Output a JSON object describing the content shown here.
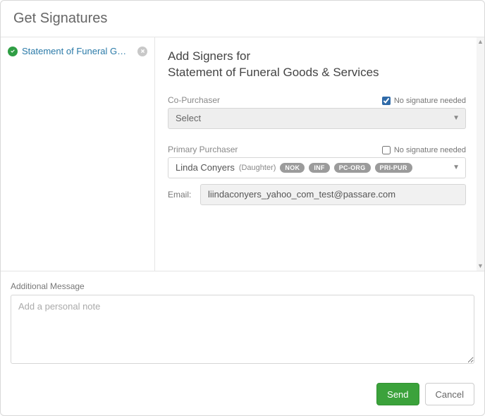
{
  "header": {
    "title": "Get Signatures"
  },
  "sidebar": {
    "documents": [
      {
        "name": "Statement of Funeral G…"
      }
    ]
  },
  "main": {
    "heading_line1": "Add Signers for",
    "heading_line2": "Statement of Funeral Goods & Services",
    "co_purchaser": {
      "label": "Co-Purchaser",
      "no_sig_label": "No signature needed",
      "no_sig_checked": true,
      "selected": "Select"
    },
    "primary_purchaser": {
      "label": "Primary Purchaser",
      "no_sig_label": "No signature needed",
      "no_sig_checked": false,
      "signer_name": "Linda Conyers",
      "signer_relation": "(Daughter)",
      "tags": [
        "NOK",
        "INF",
        "PC-ORG",
        "PRI-PUR"
      ],
      "email_label": "Email:",
      "email_value": "liindaconyers_yahoo_com_test@passare.com"
    }
  },
  "additional": {
    "label": "Additional Message",
    "placeholder": "Add a personal note",
    "value": ""
  },
  "footer": {
    "send": "Send",
    "cancel": "Cancel"
  }
}
